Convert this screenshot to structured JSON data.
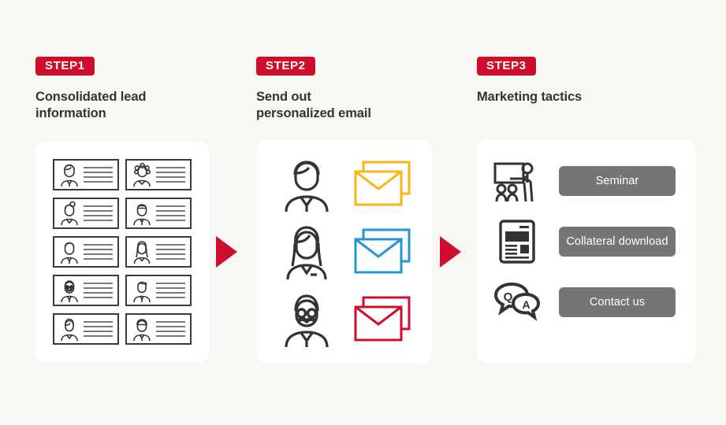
{
  "theme": {
    "background": "#f8f7f3",
    "panel_background": "#ffffff",
    "accent_red": "#ce0e2d",
    "button_gray": "#757575",
    "text_dark": "#333333",
    "envelope_yellow": "#fbb615",
    "envelope_blue": "#2196d4",
    "envelope_red": "#ce0e2d"
  },
  "steps": [
    {
      "badge": "STEP1",
      "title": "Consolidated lead information",
      "title_line1": "Consolidated lead",
      "title_line2": "information",
      "panel_name": "lead-cards-panel",
      "cards": [
        {
          "avatar": "man-short-hair-suit-icon"
        },
        {
          "avatar": "woman-curly-hair-icon"
        },
        {
          "avatar": "woman-bun-hair-icon"
        },
        {
          "avatar": "man-flat-hair-suit-icon"
        },
        {
          "avatar": "man-suit-icon"
        },
        {
          "avatar": "woman-long-hair-icon"
        },
        {
          "avatar": "man-glasses-mustache-icon"
        },
        {
          "avatar": "man-wavy-hair-tie-icon"
        },
        {
          "avatar": "woman-bob-hair-icon"
        },
        {
          "avatar": "man-cap-suit-icon"
        }
      ]
    },
    {
      "badge": "STEP2",
      "title": "Send out personalized email",
      "title_line1": "Send out",
      "title_line2": "personalized email",
      "panel_name": "email-panel",
      "rows": [
        {
          "person": "businessman-tie-icon",
          "envelope": "envelope-stack-icon",
          "color": "#fbb615",
          "color_name": "yellow"
        },
        {
          "person": "businesswoman-long-hair-icon",
          "envelope": "envelope-stack-icon",
          "color": "#2196d4",
          "color_name": "blue"
        },
        {
          "person": "senior-man-glasses-mustache-icon",
          "envelope": "envelope-stack-icon",
          "color": "#ce0e2d",
          "color_name": "red"
        }
      ]
    },
    {
      "badge": "STEP3",
      "title": "Marketing tactics",
      "title_line1": "Marketing tactics",
      "title_line2": "",
      "panel_name": "tactics-panel",
      "tactics": [
        {
          "icon": "seminar-presenter-icon",
          "label": "Seminar"
        },
        {
          "icon": "document-download-icon",
          "label": "Collateral download"
        },
        {
          "icon": "qa-speech-bubbles-icon",
          "label": "Contact us"
        }
      ]
    }
  ],
  "arrows": [
    {
      "name": "arrow-step1-to-step2",
      "direction": "right"
    },
    {
      "name": "arrow-step2-to-step3",
      "direction": "right"
    }
  ]
}
